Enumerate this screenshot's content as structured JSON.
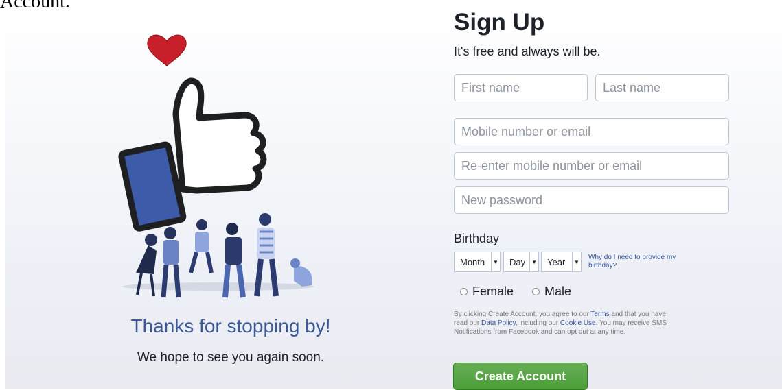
{
  "clipped_heading": "Account.",
  "left": {
    "headline": "Thanks for stopping by!",
    "subline": "We hope to see you again soon."
  },
  "signup": {
    "title": "Sign Up",
    "subtitle": "It's free and always will be.",
    "first_name_placeholder": "First name",
    "last_name_placeholder": "Last name",
    "contact_placeholder": "Mobile number or email",
    "reenter_placeholder": "Re-enter mobile number or email",
    "password_placeholder": "New password",
    "birthday_label": "Birthday",
    "month": "Month",
    "day": "Day",
    "year": "Year",
    "why_link": "Why do I need to provide my birthday?",
    "female": "Female",
    "male": "Male",
    "terms": {
      "p1": "By clicking Create Account, you agree to our ",
      "terms_link": "Terms",
      "p2": " and that you have read our ",
      "data_policy_link": "Data Policy",
      "p3": ", including our ",
      "cookie_link": "Cookie Use",
      "p4": ". You may receive SMS Notifications from Facebook and can opt out at any time."
    },
    "create_button": "Create Account"
  },
  "colors": {
    "brand_blue": "#3b5998",
    "link_blue": "#365899",
    "button_green": "#4b9e38",
    "heart_red": "#d3232f"
  }
}
